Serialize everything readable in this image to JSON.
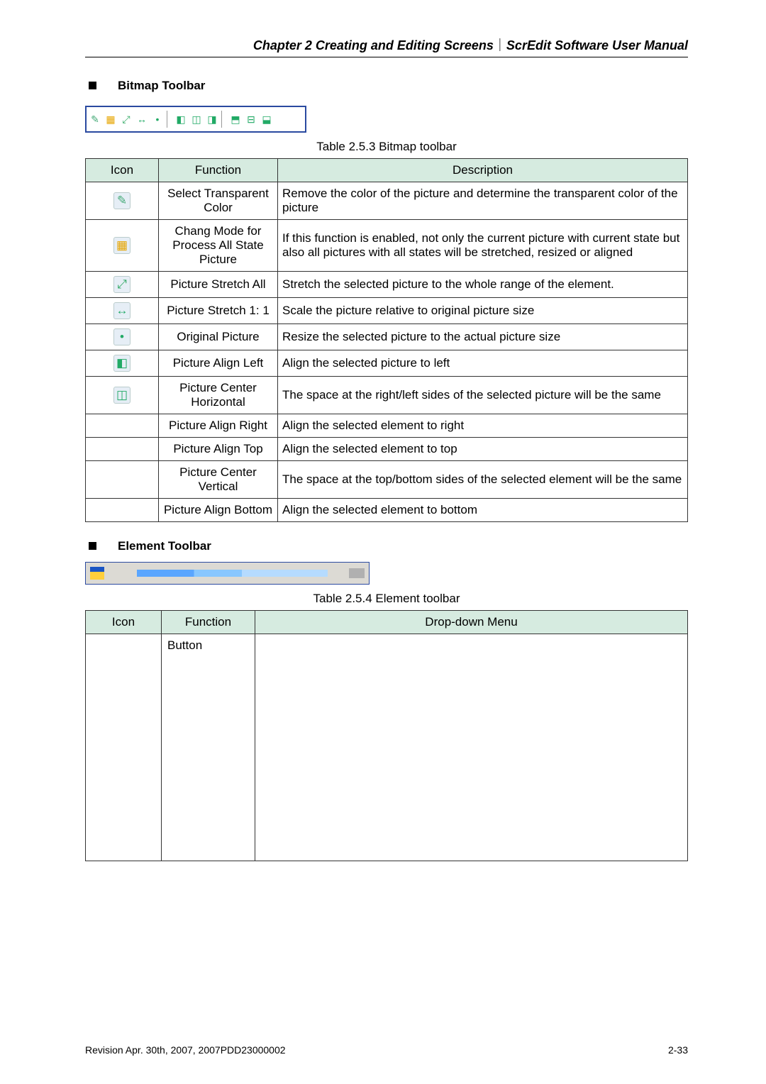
{
  "header": {
    "chapter": "Chapter 2  Creating and Editing Screens",
    "sep": "｜",
    "doc": "ScrEdit Software User Manual"
  },
  "section1": {
    "title": "Bitmap Toolbar",
    "caption": "Table 2.5.3 Bitmap toolbar",
    "cols": {
      "icon": "Icon",
      "func": "Function",
      "desc": "Description"
    },
    "rows": [
      {
        "icon": "pen-icon",
        "func": "Select Transparent Color",
        "desc": "Remove the color of the picture and determine the transparent color of the picture"
      },
      {
        "icon": "mode-icon",
        "func": "Chang Mode for Process All State Picture",
        "desc": "If this function is enabled, not only the current picture with current state but also all pictures with all states will be stretched, resized or aligned"
      },
      {
        "icon": "stretch-all-icon",
        "func": "Picture Stretch All",
        "desc": "Stretch the selected picture to the whole range of the element."
      },
      {
        "icon": "stretch-11-icon",
        "func": "Picture Stretch 1: 1",
        "desc": "Scale the picture relative to original picture size"
      },
      {
        "icon": "original-icon",
        "func": "Original Picture",
        "desc": "Resize the selected picture to the actual picture size"
      },
      {
        "icon": "align-left-icon",
        "func": "Picture Align Left",
        "desc": "Align the selected picture to left"
      },
      {
        "icon": "center-horiz-icon",
        "func": "Picture Center Horizontal",
        "desc": "The space at the right/left sides of the selected picture will be the same"
      },
      {
        "icon": "",
        "func": "Picture Align Right",
        "desc": "Align the selected element to right"
      },
      {
        "icon": "",
        "func": "Picture Align Top",
        "desc": "Align the selected element to top"
      },
      {
        "icon": "",
        "func": "Picture Center Vertical",
        "desc": "The space at the top/bottom sides of the selected element will be the same"
      },
      {
        "icon": "",
        "func": "Picture Align Bottom",
        "desc": "Align the selected element to bottom"
      }
    ]
  },
  "toolbar_icons": [
    {
      "name": "pen-icon",
      "cls": "ico-pen"
    },
    {
      "name": "mode-icon",
      "cls": "ico-mode"
    },
    {
      "name": "stretch-all-icon",
      "cls": "ico-stretch"
    },
    {
      "name": "stretch-11-icon",
      "cls": "ico-s11"
    },
    {
      "name": "original-icon",
      "cls": "ico-orig"
    },
    {
      "name": "sep1",
      "sep": true
    },
    {
      "name": "align-left-icon",
      "cls": "ico-left"
    },
    {
      "name": "center-horiz-icon",
      "cls": "ico-ctrh"
    },
    {
      "name": "align-right-icon",
      "cls": "ico-right"
    },
    {
      "name": "sep2",
      "sep": true
    },
    {
      "name": "align-top-icon",
      "cls": "ico-top"
    },
    {
      "name": "center-vert-icon",
      "cls": "ico-ctrv"
    },
    {
      "name": "align-bottom-icon",
      "cls": "ico-bot"
    }
  ],
  "section2": {
    "title": "Element Toolbar",
    "caption": "Table 2.5.4 Element toolbar",
    "cols": {
      "icon": "Icon",
      "func": "Function",
      "menu": "Drop-down Menu"
    },
    "rows": [
      {
        "func": "Button"
      }
    ]
  },
  "footer": {
    "left": "Revision Apr. 30th, 2007, 2007PDD23000002",
    "right": "2-33"
  }
}
